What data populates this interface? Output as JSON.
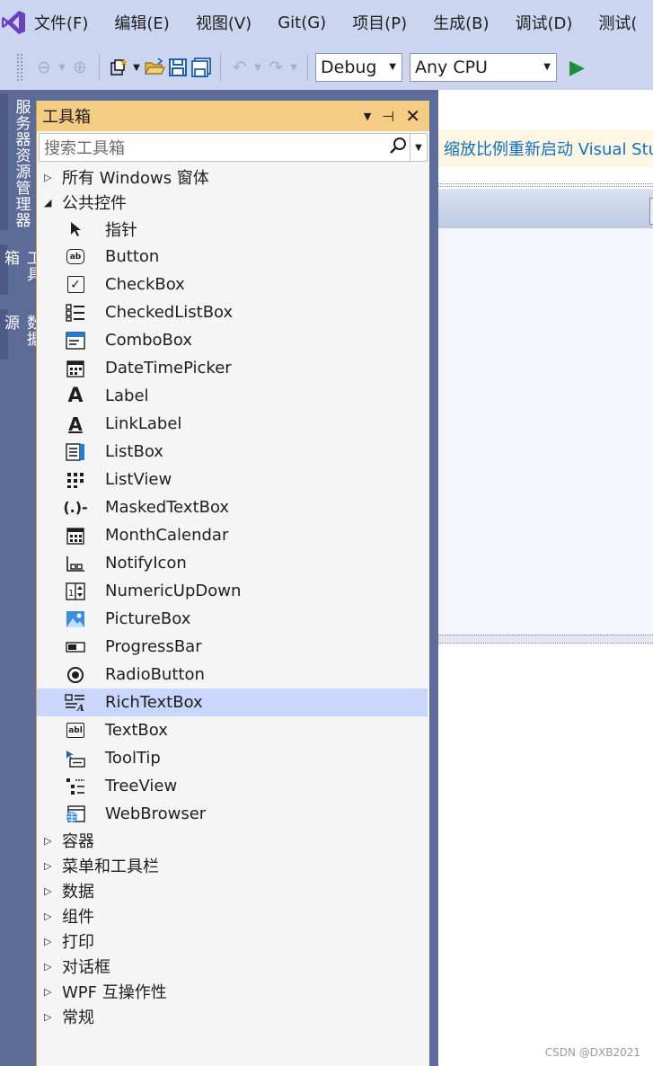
{
  "menu": [
    "文件(F)",
    "编辑(E)",
    "视图(V)",
    "Git(G)",
    "项目(P)",
    "生成(B)",
    "调试(D)",
    "测试("
  ],
  "toolbar": {
    "config": "Debug",
    "platform": "Any CPU"
  },
  "left_tabs": [
    "服务器资源管理器",
    "工具箱",
    "数据源"
  ],
  "toolbox": {
    "title": "工具箱",
    "search_placeholder": "搜索工具箱",
    "categories_top": [
      {
        "label": "所有 Windows 窗体",
        "expanded": false
      },
      {
        "label": "公共控件",
        "expanded": true
      }
    ],
    "items": [
      {
        "label": "指针",
        "icon": "pointer-icon"
      },
      {
        "label": "Button",
        "icon": "button-icon"
      },
      {
        "label": "CheckBox",
        "icon": "checkbox-icon"
      },
      {
        "label": "CheckedListBox",
        "icon": "checkedlistbox-icon"
      },
      {
        "label": "ComboBox",
        "icon": "combobox-icon"
      },
      {
        "label": "DateTimePicker",
        "icon": "datetimepicker-icon"
      },
      {
        "label": "Label",
        "icon": "label-icon"
      },
      {
        "label": "LinkLabel",
        "icon": "linklabel-icon"
      },
      {
        "label": "ListBox",
        "icon": "listbox-icon"
      },
      {
        "label": "ListView",
        "icon": "listview-icon"
      },
      {
        "label": "MaskedTextBox",
        "icon": "maskedtextbox-icon"
      },
      {
        "label": "MonthCalendar",
        "icon": "monthcalendar-icon"
      },
      {
        "label": "NotifyIcon",
        "icon": "notifyicon-icon"
      },
      {
        "label": "NumericUpDown",
        "icon": "numericupdown-icon"
      },
      {
        "label": "PictureBox",
        "icon": "picturebox-icon"
      },
      {
        "label": "ProgressBar",
        "icon": "progressbar-icon"
      },
      {
        "label": "RadioButton",
        "icon": "radiobutton-icon"
      },
      {
        "label": "RichTextBox",
        "icon": "richtextbox-icon",
        "selected": true
      },
      {
        "label": "TextBox",
        "icon": "textbox-icon"
      },
      {
        "label": "ToolTip",
        "icon": "tooltip-icon"
      },
      {
        "label": "TreeView",
        "icon": "treeview-icon"
      },
      {
        "label": "WebBrowser",
        "icon": "webbrowser-icon"
      }
    ],
    "categories_bottom": [
      "容器",
      "菜单和工具栏",
      "数据",
      "组件",
      "打印",
      "对话框",
      "WPF 互操作性",
      "常规"
    ]
  },
  "infobar_text": "缩放比例重新启动 Visual Stu",
  "watermark": "CSDN @DXB2021",
  "colors": {
    "chrome": "#ccd5f0",
    "sidebar": "#5d6b99",
    "toolbox_title": "#f5cc84",
    "selected": "#c9d7fc",
    "link": "#0e70c0"
  }
}
